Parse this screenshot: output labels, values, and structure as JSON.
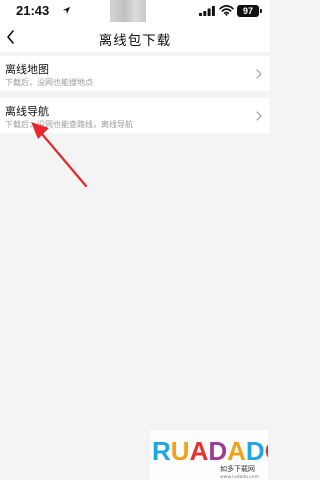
{
  "status_bar": {
    "time": "21:43",
    "battery": "97"
  },
  "header": {
    "title": "离线包下载"
  },
  "list": [
    {
      "title": "离线地图",
      "subtitle": "下载后，没网也能搜地点"
    },
    {
      "title": "离线导航",
      "subtitle": "下载后，没网也能查路线，离线导航"
    }
  ],
  "watermark": {
    "logo": "RUADADO",
    "text": "如多下载网",
    "url": "www.rudado.com"
  },
  "colors": {
    "annotation": "#e8262c",
    "background": "#f4f4f4"
  },
  "icons": [
    "location-icon",
    "signal-icon",
    "wifi-icon",
    "back-icon",
    "chevron-right-icon"
  ]
}
